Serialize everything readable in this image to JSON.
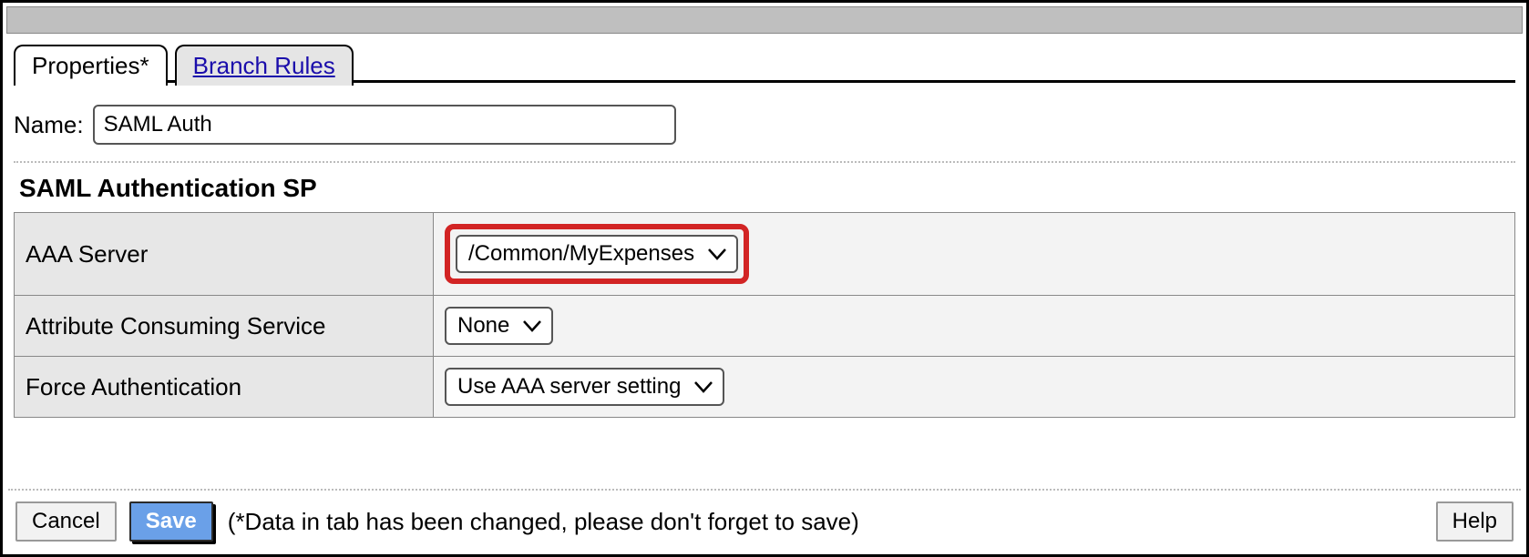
{
  "tabs": {
    "properties": "Properties*",
    "branch_rules": "Branch Rules"
  },
  "name_label": "Name:",
  "name_value": "SAML Auth",
  "section_title": "SAML Authentication SP",
  "rows": {
    "aaa_server": {
      "label": "AAA Server",
      "value": "/Common/MyExpenses"
    },
    "attr_consuming": {
      "label": "Attribute Consuming Service",
      "value": "None"
    },
    "force_auth": {
      "label": "Force Authentication",
      "value": "Use AAA server setting"
    }
  },
  "footer": {
    "cancel": "Cancel",
    "save": "Save",
    "note": "(*Data in tab has been changed, please don't forget to save)",
    "help": "Help"
  }
}
